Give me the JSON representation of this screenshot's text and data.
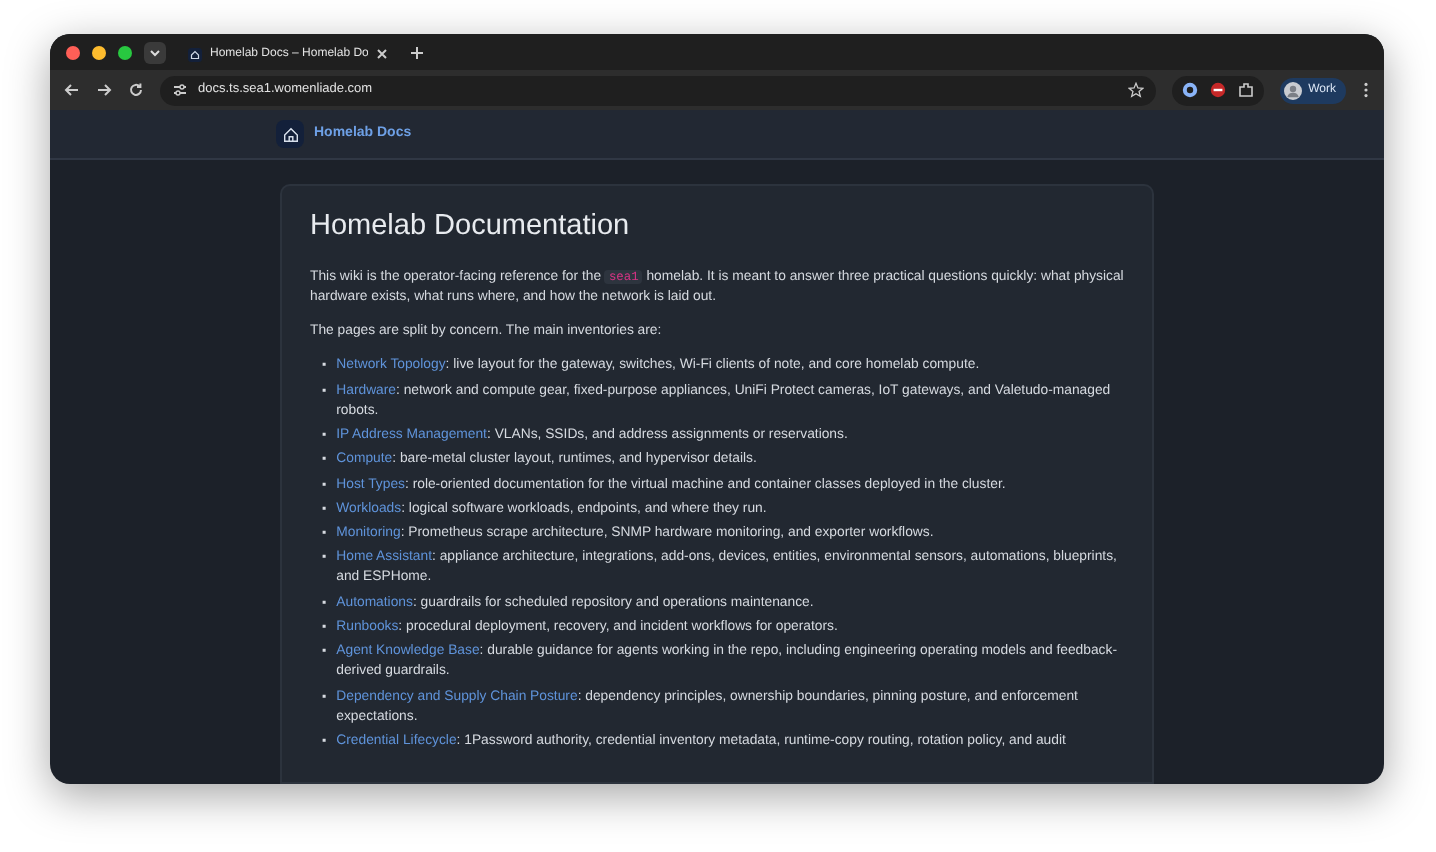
{
  "browser": {
    "tab_title": "Homelab Docs – Homelab Do",
    "url": "docs.ts.sea1.womenliade.com",
    "profile": "Work"
  },
  "site": {
    "title": "Homelab Docs"
  },
  "page": {
    "heading": "Homelab Documentation",
    "intro": {
      "before": "This wiki is the operator-facing reference for the ",
      "code": "sea1",
      "after": " homelab. It is meant to answer three practical questions quickly: what physical hardware exists, what runs where, and how the network is laid out."
    },
    "lead": "The pages are split by concern. The main inventories are:",
    "items": [
      {
        "bullet": "▪",
        "link": "Network Topology",
        "text": ": live layout for the gateway, switches, Wi-Fi clients of note, and core homelab compute."
      },
      {
        "bullet": "▪",
        "link": "Hardware",
        "text": ": network and compute gear, fixed-purpose appliances, UniFi Protect cameras, IoT gateways, and Valetudo-managed robots."
      },
      {
        "bullet": "▪",
        "link": "IP Address Management",
        "text": ": VLANs, SSIDs, and address assignments or reservations."
      },
      {
        "bullet": "▪",
        "link": "Compute",
        "text": ": bare-metal cluster layout, runtimes, and hypervisor details."
      },
      {
        "bullet": "▪",
        "link": "Host Types",
        "text": ": role-oriented documentation for the virtual machine and container classes deployed in the cluster."
      },
      {
        "bullet": "▪",
        "link": "Workloads",
        "text": ": logical software workloads, endpoints, and where they run."
      },
      {
        "bullet": "▪",
        "link": "Monitoring",
        "text": ": Prometheus scrape architecture, SNMP hardware monitoring, and exporter workflows."
      },
      {
        "bullet": "▪",
        "link": "Home Assistant",
        "text": ": appliance architecture, integrations, add-ons, devices, entities, environmental sensors, automations, blueprints, and ESPHome."
      },
      {
        "bullet": "▪",
        "link": "Automations",
        "text": ": guardrails for scheduled repository and operations maintenance."
      },
      {
        "bullet": "▪",
        "link": "Runbooks",
        "text": ": procedural deployment, recovery, and incident workflows for operators."
      },
      {
        "bullet": "▪",
        "link": "Agent Knowledge Base",
        "text": ": durable guidance for agents working in the repo, including engineering operating models and feedback-derived guardrails."
      },
      {
        "bullet": "▪",
        "link": "Dependency and Supply Chain Posture",
        "text": ": dependency principles, ownership boundaries, pinning posture, and enforcement expectations."
      },
      {
        "bullet": "▪",
        "link": "Credential Lifecycle",
        "text": ": 1Password authority, credential inventory metadata, runtime-copy routing, rotation policy, and audit"
      }
    ]
  }
}
